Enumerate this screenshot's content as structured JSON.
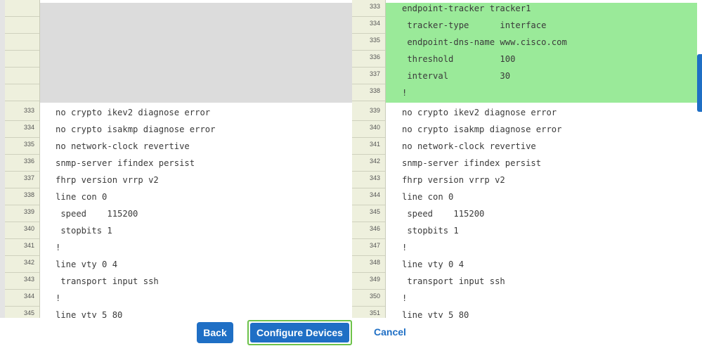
{
  "left_pane": {
    "blank_gutter_rows": 6,
    "lines": [
      {
        "num": "333",
        "text": "no crypto ikev2 diagnose error"
      },
      {
        "num": "334",
        "text": "no crypto isakmp diagnose error"
      },
      {
        "num": "335",
        "text": "no network-clock revertive"
      },
      {
        "num": "336",
        "text": "snmp-server ifindex persist"
      },
      {
        "num": "337",
        "text": "fhrp version vrrp v2"
      },
      {
        "num": "338",
        "text": "line con 0"
      },
      {
        "num": "339",
        "text": " speed    115200"
      },
      {
        "num": "340",
        "text": " stopbits 1"
      },
      {
        "num": "341",
        "text": "!"
      },
      {
        "num": "342",
        "text": "line vty 0 4"
      },
      {
        "num": "343",
        "text": " transport input ssh"
      },
      {
        "num": "344",
        "text": "!"
      },
      {
        "num": "345",
        "text": "line vty 5 80"
      }
    ]
  },
  "right_pane": {
    "added_lines": [
      {
        "num": "333",
        "text": "endpoint-tracker tracker1"
      },
      {
        "num": "334",
        "text": " tracker-type      interface"
      },
      {
        "num": "335",
        "text": " endpoint-dns-name www.cisco.com"
      },
      {
        "num": "336",
        "text": " threshold         100"
      },
      {
        "num": "337",
        "text": " interval          30"
      },
      {
        "num": "338",
        "text": "!"
      }
    ],
    "lines": [
      {
        "num": "339",
        "text": "no crypto ikev2 diagnose error"
      },
      {
        "num": "340",
        "text": "no crypto isakmp diagnose error"
      },
      {
        "num": "341",
        "text": "no network-clock revertive"
      },
      {
        "num": "342",
        "text": "snmp-server ifindex persist"
      },
      {
        "num": "343",
        "text": "fhrp version vrrp v2"
      },
      {
        "num": "344",
        "text": "line con 0"
      },
      {
        "num": "345",
        "text": " speed    115200"
      },
      {
        "num": "346",
        "text": " stopbits 1"
      },
      {
        "num": "347",
        "text": "!"
      },
      {
        "num": "348",
        "text": "line vty 0 4"
      },
      {
        "num": "349",
        "text": " transport input ssh"
      },
      {
        "num": "350",
        "text": "!"
      },
      {
        "num": "351",
        "text": "line vty 5 80"
      }
    ]
  },
  "footer": {
    "back_label": "Back",
    "configure_label": "Configure Devices",
    "cancel_label": "Cancel"
  },
  "colors": {
    "primary": "#1f6fc5",
    "added_line_bg": "#9aea99",
    "blank_block_bg": "#dcdcdc",
    "gutter_bg": "#eef0dd",
    "focus_outline": "#6cc24a"
  }
}
